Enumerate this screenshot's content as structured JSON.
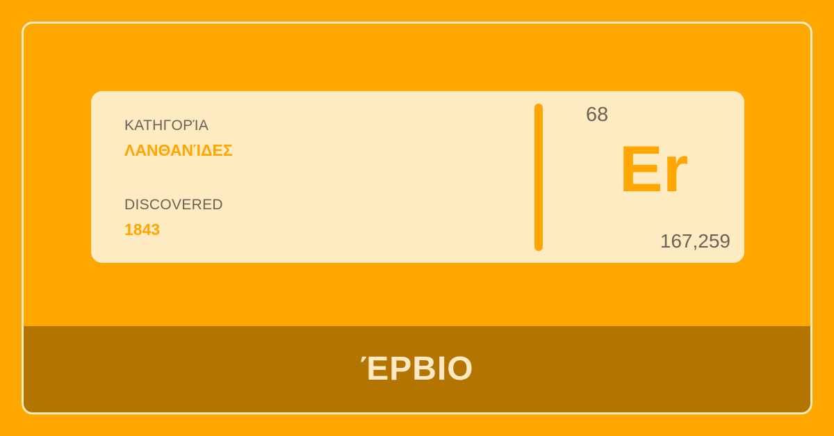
{
  "element": {
    "category_label": "ΚΑΤΗΓΟΡΊΑ",
    "category_value": "ΛΑΝΘΑΝΊΔΕΣ",
    "discovered_label": "DISCOVERED",
    "discovered_value": "1843",
    "atomic_number": "68",
    "symbol": "Er",
    "atomic_mass": "167,259",
    "name": "ΈΡΒΙΟ"
  },
  "colors": {
    "background": "#FFA600",
    "card": "#FFEBC1",
    "footer": "#B37400",
    "accent": "#FFA600",
    "text_dark": "#6B6155",
    "footer_text": "#FFE9C4"
  }
}
